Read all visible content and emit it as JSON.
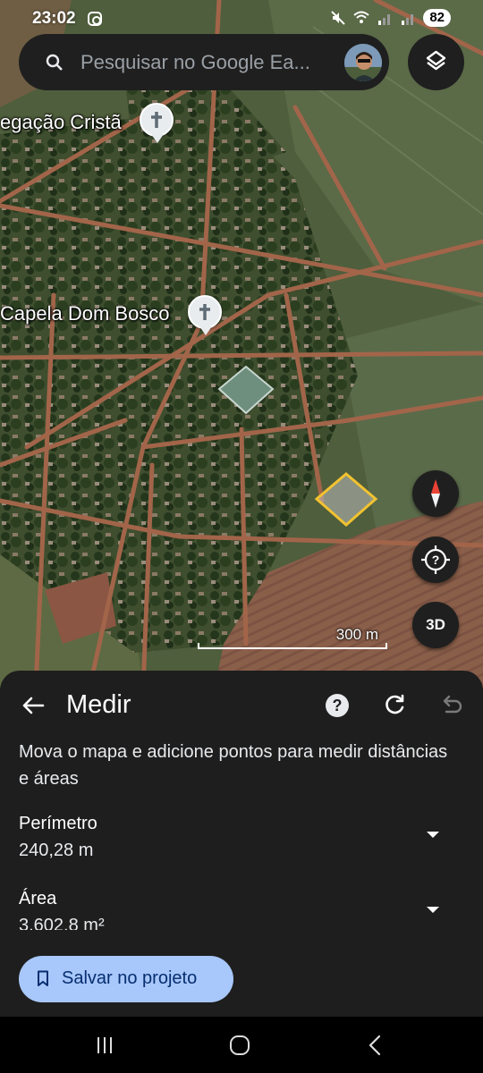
{
  "status_bar": {
    "time": "23:02",
    "battery": "82",
    "icons": [
      "instagram-icon",
      "mute-icon",
      "wifi-icon",
      "signal-icon",
      "signal-icon",
      "battery-icon"
    ]
  },
  "search": {
    "placeholder": "Pesquisar no Google Ea..."
  },
  "map": {
    "labels": [
      {
        "text": "egação Cristã",
        "icon": "church-icon"
      },
      {
        "text": "Capela Dom Bosco",
        "icon": "church-icon"
      }
    ],
    "scale": "300 m",
    "button_3d": "3D",
    "measure_color": "#f2c230"
  },
  "sheet": {
    "title": "Medir",
    "instructions": "Mova o mapa e adicione pontos para medir distâncias e áreas",
    "perimeter_label": "Perímetro",
    "perimeter_value": "240,28 m",
    "area_label": "Área",
    "area_value": "3.602,8 m²",
    "save_label": "Salvar no projeto",
    "accent": "#a8c7fa"
  },
  "nav": {
    "icons": [
      "recent-apps-icon",
      "home-icon",
      "back-icon"
    ]
  }
}
